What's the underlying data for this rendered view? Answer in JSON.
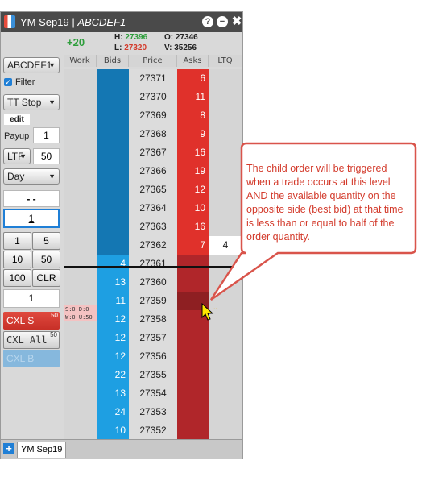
{
  "window": {
    "title_prefix": "YM Sep19 | ",
    "title_account": "ABCDEF1",
    "icons": [
      "help-icon",
      "minimize-icon",
      "close-icon"
    ]
  },
  "header": {
    "pnl": "+20",
    "high_label": "H:",
    "high_value": "27396",
    "low_label": "L:",
    "low_value": "27320",
    "open_label": "O:",
    "open_value": "27346",
    "volume_label": "V:",
    "volume_value": "35256"
  },
  "columns": [
    "Work",
    "Bids",
    "Price",
    "Asks",
    "LTQ"
  ],
  "left_panel": {
    "account": "ABCDEF1",
    "filter_label": "Filter",
    "filter_checked": true,
    "order_type": "TT Stop",
    "edit_label": "edit",
    "payup_label": "Payup",
    "payup_value": "1",
    "ltf_label": "LTF",
    "ltf_value": "50",
    "tif": "Day",
    "price_display": "- -",
    "qty_input": "1",
    "qty_buttons": [
      "1",
      "5",
      "10",
      "50",
      "100",
      "CLR"
    ],
    "qty_display": "1",
    "cxl_s": "CXL S",
    "cxl_s_count": "50",
    "cxl_all": "CXL All",
    "cxl_all_count": "50",
    "cxl_b": "CXL B"
  },
  "ladder": [
    {
      "price": "27371",
      "bid": "",
      "ask": "6",
      "ltq": "",
      "work": ""
    },
    {
      "price": "27370",
      "bid": "",
      "ask": "11",
      "ltq": "",
      "work": ""
    },
    {
      "price": "27369",
      "bid": "",
      "ask": "8",
      "ltq": "",
      "work": ""
    },
    {
      "price": "27368",
      "bid": "",
      "ask": "9",
      "ltq": "",
      "work": ""
    },
    {
      "price": "27367",
      "bid": "",
      "ask": "16",
      "ltq": "",
      "work": ""
    },
    {
      "price": "27366",
      "bid": "",
      "ask": "19",
      "ltq": "",
      "work": ""
    },
    {
      "price": "27365",
      "bid": "",
      "ask": "12",
      "ltq": "",
      "work": ""
    },
    {
      "price": "27364",
      "bid": "",
      "ask": "10",
      "ltq": "",
      "work": ""
    },
    {
      "price": "27363",
      "bid": "",
      "ask": "16",
      "ltq": "",
      "work": ""
    },
    {
      "price": "27362",
      "bid": "",
      "ask": "7",
      "ltq": "4",
      "work": ""
    },
    {
      "price": "27361",
      "bid": "4",
      "ask": "",
      "ltq": "",
      "work": ""
    },
    {
      "price": "27360",
      "bid": "13",
      "ask": "",
      "ltq": "",
      "work": ""
    },
    {
      "price": "27359",
      "bid": "11",
      "ask": "",
      "ltq": "",
      "work": ""
    },
    {
      "price": "27358",
      "bid": "12",
      "ask": "",
      "ltq": "",
      "work": ""
    },
    {
      "price": "27357",
      "bid": "12",
      "ask": "",
      "ltq": "",
      "work": ""
    },
    {
      "price": "27356",
      "bid": "12",
      "ask": "",
      "ltq": "",
      "work": ""
    },
    {
      "price": "27355",
      "bid": "22",
      "ask": "",
      "ltq": "",
      "work": ""
    },
    {
      "price": "27354",
      "bid": "13",
      "ask": "",
      "ltq": "",
      "work": ""
    },
    {
      "price": "27353",
      "bid": "24",
      "ask": "",
      "ltq": "",
      "work": ""
    },
    {
      "price": "27352",
      "bid": "10",
      "ask": "",
      "ltq": "",
      "work": ""
    }
  ],
  "working_order": {
    "line1": "S:0  D:0",
    "line2": "W:0  U:50"
  },
  "bottom": {
    "add_tab": "+",
    "tab_label": "YM Sep19"
  },
  "callout": {
    "text": "The child order will be triggered when a trade occurs at this level AND the available quantity on the opposite side  (best bid) at that time is less than or equal to half of the order quantity."
  },
  "colors": {
    "bid_dark": "#1477b3",
    "bid_light": "#1e9fe2",
    "ask_light": "#e0312b",
    "ask_dark": "#b0262a",
    "callout_border": "#d9544b",
    "callout_text": "#d33a2b"
  }
}
